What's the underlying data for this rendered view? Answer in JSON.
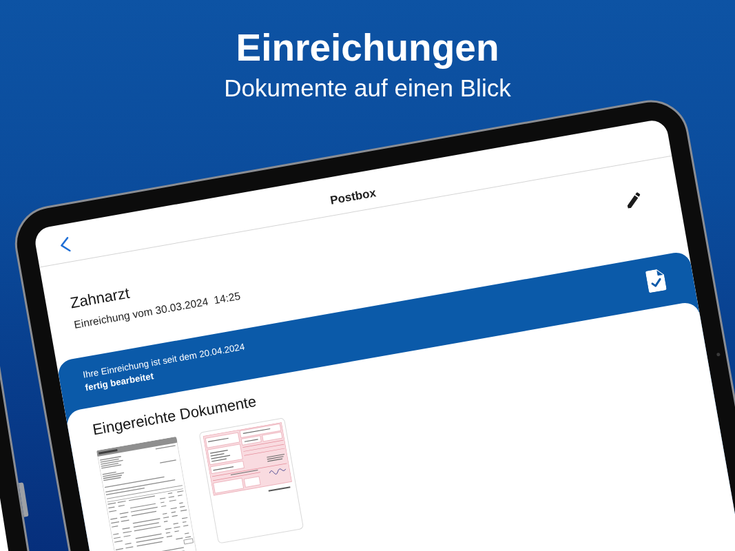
{
  "promo": {
    "title": "Einreichungen",
    "subtitle": "Dokumente auf einen Blick"
  },
  "nav_bar": {
    "title": "Postbox"
  },
  "submission": {
    "title": "Zahnarzt",
    "date": "Einreichung vom 30.03.2024  14:25"
  },
  "status_banner": {
    "message": "Ihre Einreichung ist seit dem 20.04.2024",
    "status": "fertig bearbeitet"
  },
  "documents": {
    "heading": "Eingereichte Dokumente",
    "items": [
      {
        "kind": "invoice"
      },
      {
        "kind": "form"
      }
    ]
  }
}
